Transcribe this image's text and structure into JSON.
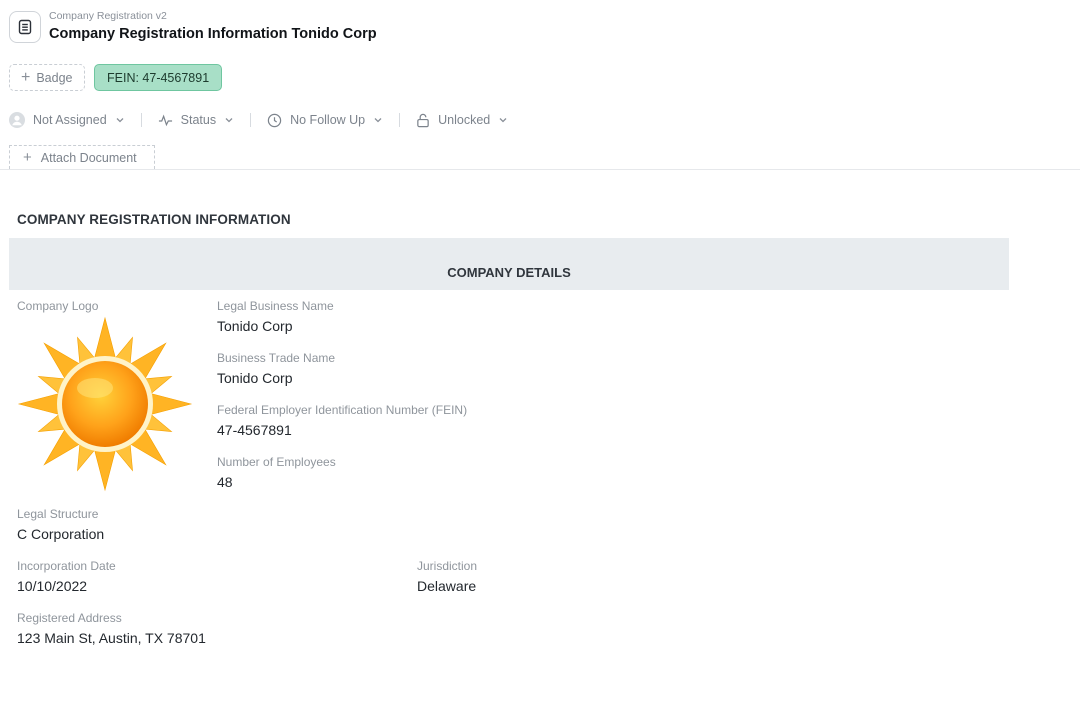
{
  "header": {
    "subtitle": "Company Registration v2",
    "title": "Company Registration Information Tonido Corp",
    "icon": "document-icon"
  },
  "badges": {
    "add_label": "Badge",
    "fein_badge": "FEIN: 47-4567891",
    "fein_badge_color": "#a8dfc7"
  },
  "status_bar": {
    "assignee": "Not Assigned",
    "status": "Status",
    "follow_up": "No Follow Up",
    "lock": "Unlocked"
  },
  "attach_label": "Attach Document",
  "section_title": "COMPANY REGISTRATION INFORMATION",
  "details_header": "COMPANY DETAILS",
  "fields": {
    "logo_label": "Company Logo",
    "legal_name": {
      "label": "Legal Business Name",
      "value": "Tonido Corp"
    },
    "trade_name": {
      "label": "Business Trade Name",
      "value": "Tonido Corp"
    },
    "fein": {
      "label": "Federal Employer Identification Number (FEIN)",
      "value": "47-4567891"
    },
    "employees": {
      "label": "Number of Employees",
      "value": "48"
    },
    "legal_structure": {
      "label": "Legal Structure",
      "value": "C Corporation"
    },
    "incorporation_date": {
      "label": "Incorporation Date",
      "value": "10/10/2022"
    },
    "jurisdiction": {
      "label": "Jurisdiction",
      "value": "Delaware"
    },
    "registered_address": {
      "label": "Registered Address",
      "value": "123 Main St, Austin, TX 78701"
    }
  }
}
